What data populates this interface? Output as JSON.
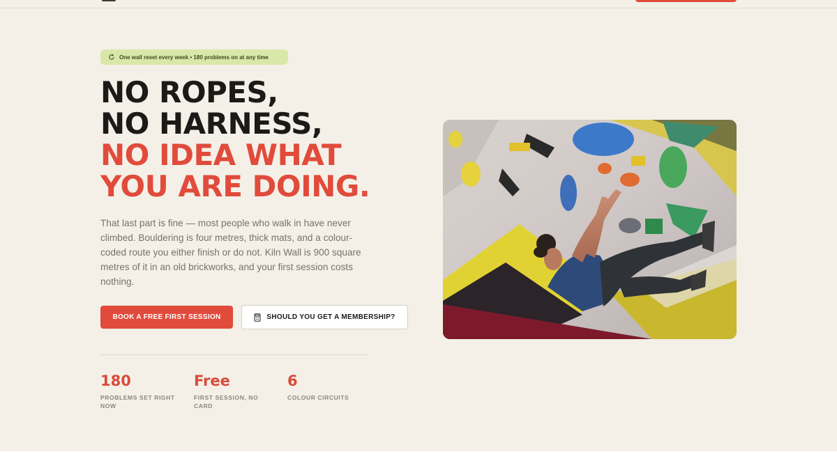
{
  "badge": {
    "icon": "refresh-icon",
    "text": "One wall reset every week • 180 problems on at any time"
  },
  "headline": {
    "line1": "NO ROPES,",
    "line2": "NO HARNESS,",
    "line3": "NO IDEA WHAT",
    "line4": "YOU ARE DOING."
  },
  "lede": "That last part is fine — most people who walk in have never climbed. Bouldering is four metres, thick mats, and a colour-coded route you either finish or do not. Kiln Wall is 900 square metres of it in an old brickworks, and your first session costs nothing.",
  "buttons": {
    "primary": "BOOK A FREE FIRST SESSION",
    "secondary": "SHOULD YOU GET A MEMBERSHIP?",
    "secondary_icon": "calculator-icon"
  },
  "stats": [
    {
      "value": "180",
      "label": "PROBLEMS SET RIGHT NOW"
    },
    {
      "value": "Free",
      "label": "FIRST SESSION, NO CARD"
    },
    {
      "value": "6",
      "label": "COLOUR CIRCUITS"
    }
  ],
  "colors": {
    "accent": "#e14b3b",
    "background": "#f4f0e8",
    "badge_bg": "#d9e8a8"
  }
}
